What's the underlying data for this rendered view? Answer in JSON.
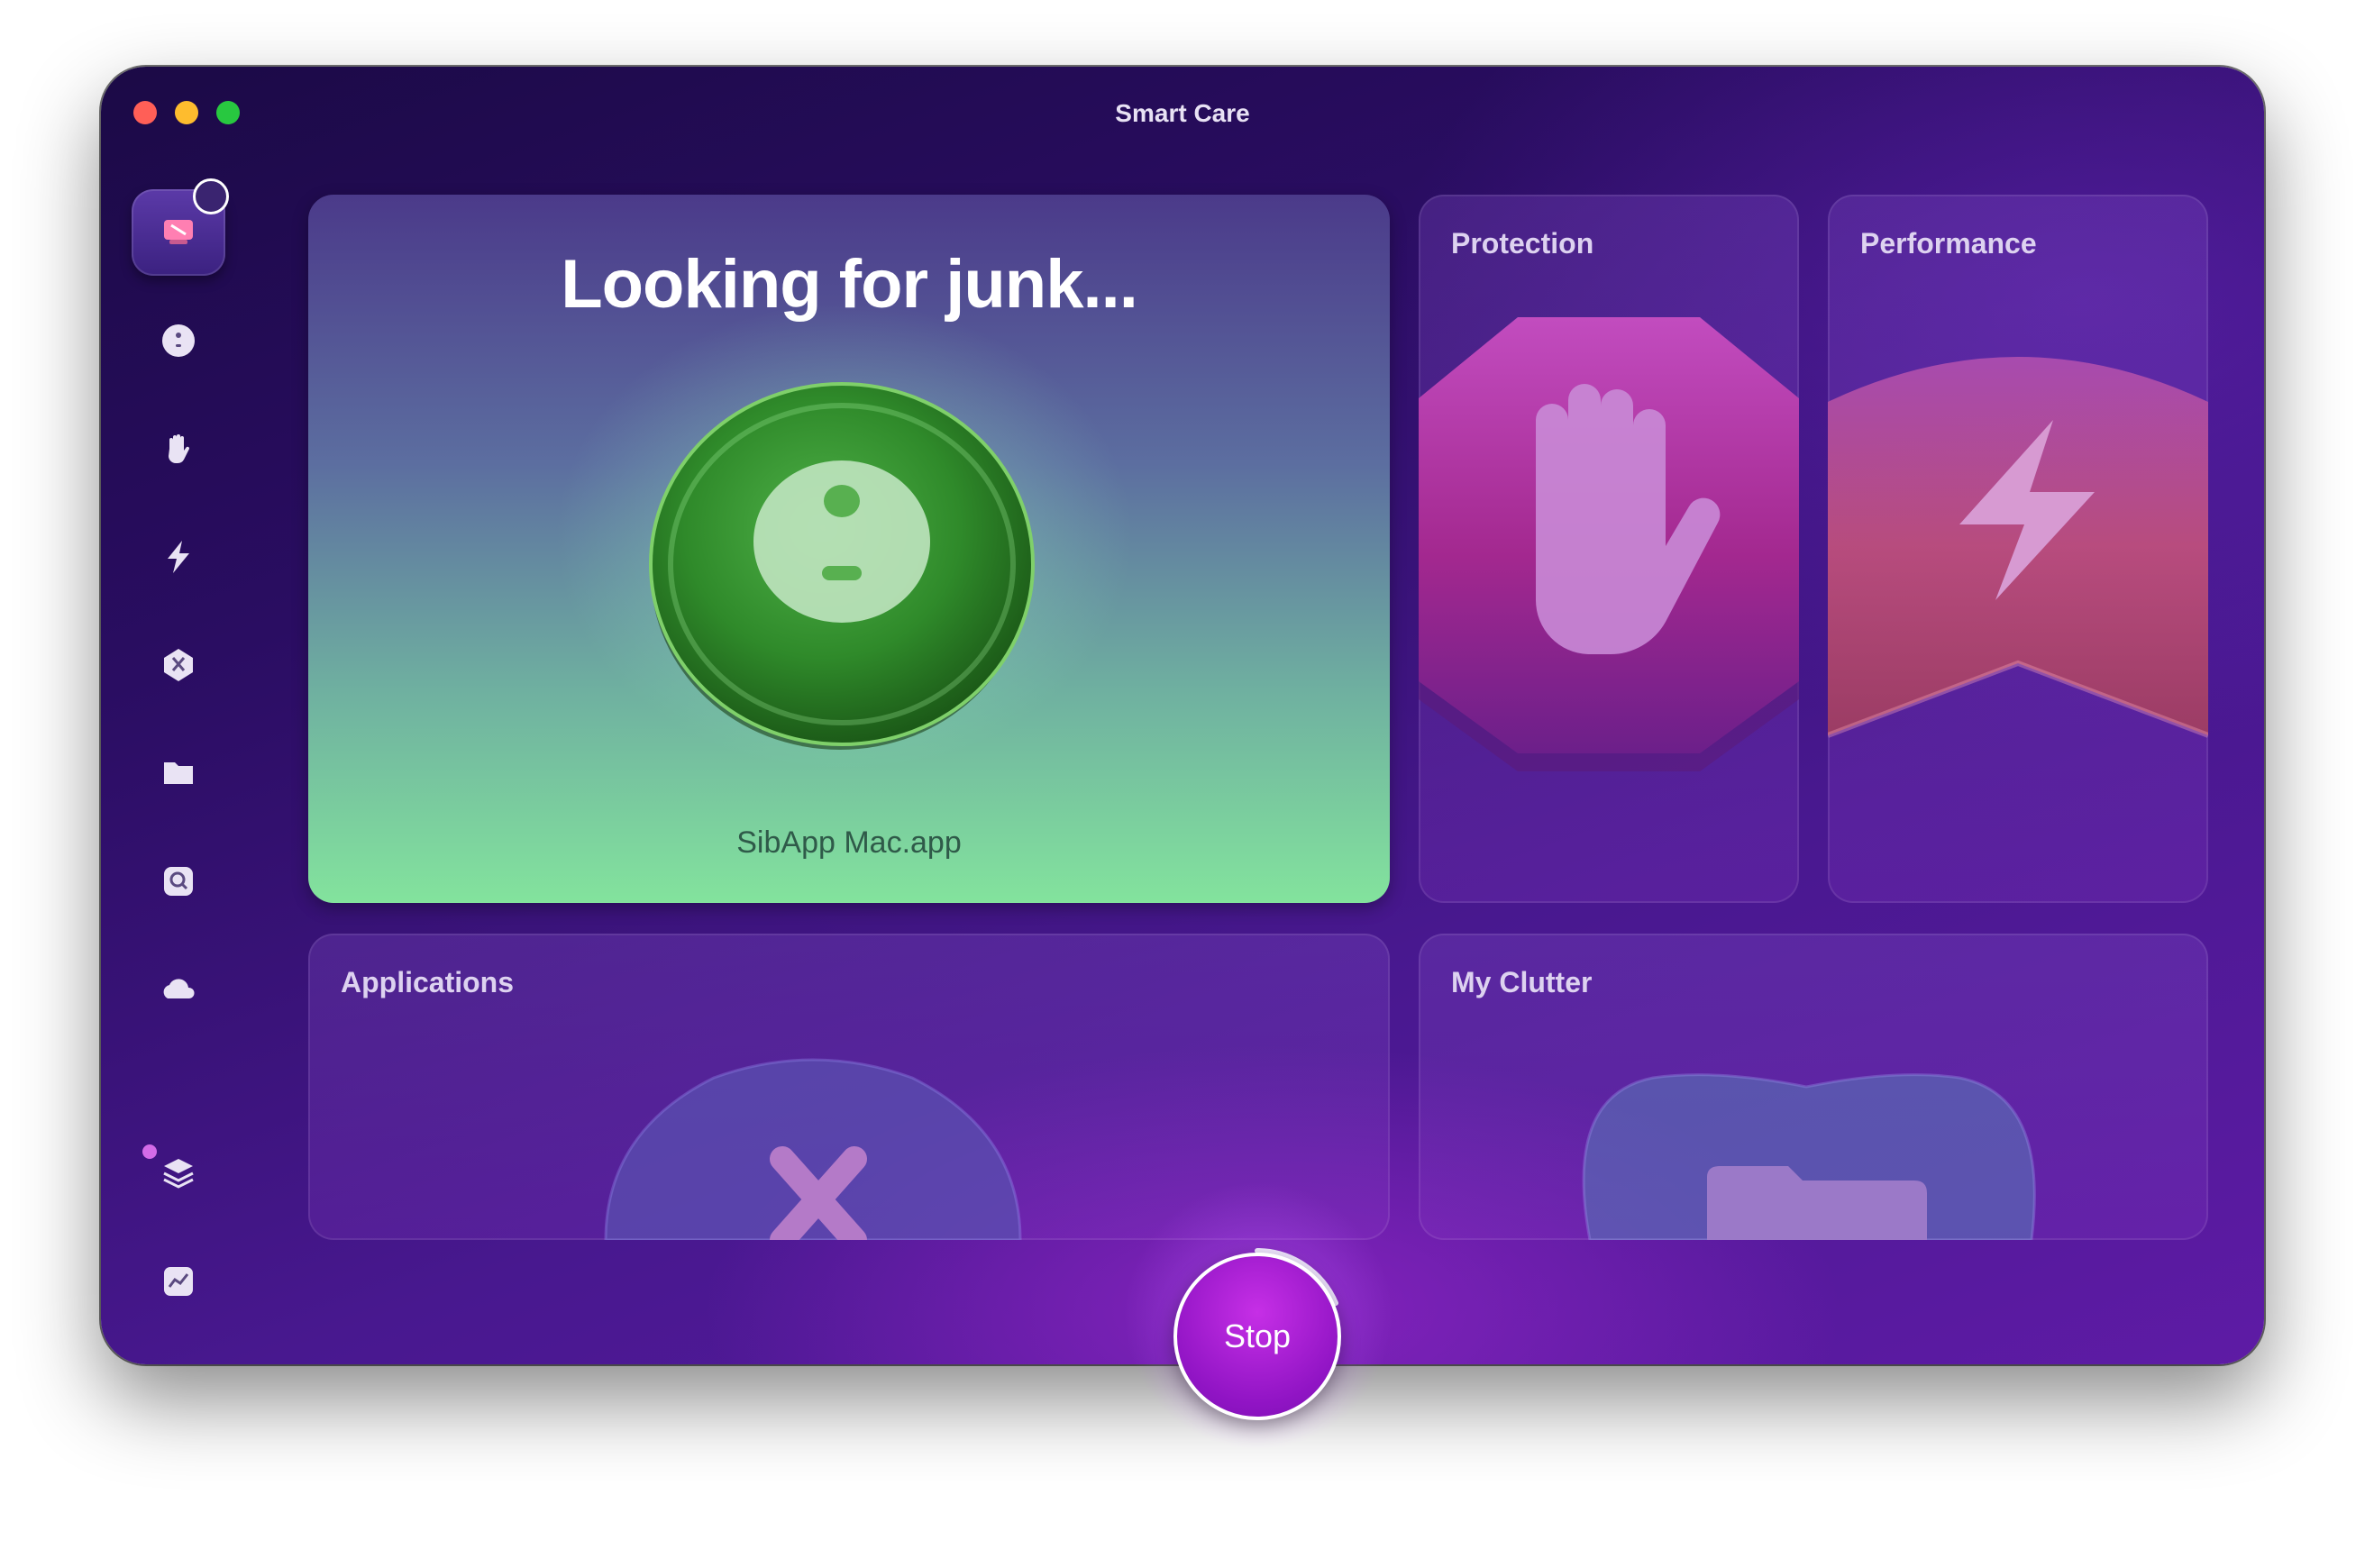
{
  "window": {
    "title": "Smart Care"
  },
  "sidebar": {
    "items": [
      {
        "icon": "smart-care-icon",
        "active": true
      },
      {
        "icon": "cleanup-icon"
      },
      {
        "icon": "protection-icon"
      },
      {
        "icon": "performance-icon"
      },
      {
        "icon": "applications-icon"
      },
      {
        "icon": "my-clutter-icon"
      },
      {
        "icon": "space-lens-icon"
      },
      {
        "icon": "cloud-cleanup-icon"
      },
      {
        "icon": "assistant-icon"
      },
      {
        "icon": "menu-app-icon"
      }
    ]
  },
  "cards": {
    "junk": {
      "title": "Looking for junk...",
      "file": "SibApp Mac.app"
    },
    "protection": {
      "label": "Protection"
    },
    "performance": {
      "label": "Performance"
    },
    "applications": {
      "label": "Applications"
    },
    "clutter": {
      "label": "My Clutter"
    }
  },
  "actions": {
    "stop_label": "Stop"
  },
  "colors": {
    "accent": "#a21cd6",
    "junk_green": "#83e39d"
  }
}
